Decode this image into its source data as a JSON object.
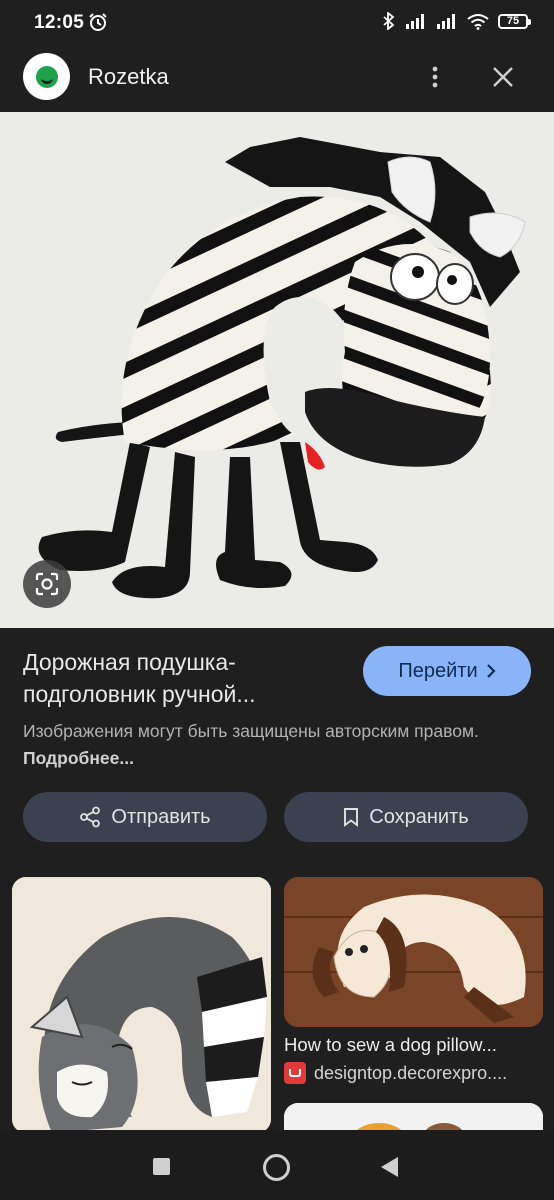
{
  "status_bar": {
    "time": "12:05",
    "battery": "75"
  },
  "app_bar": {
    "site_name": "Rozetka"
  },
  "result": {
    "title_line1": "Дорожная подушка-",
    "title_line2": "подголовник ручной...",
    "go_button": "Перейти",
    "copyright_text": "Изображения могут быть защищены авторским правом.",
    "copyright_link": "Подробнее..."
  },
  "actions": {
    "share": "Отправить",
    "save": "Сохранить"
  },
  "related": [
    {
      "title": "",
      "source": ""
    },
    {
      "title": "How to sew a dog pillow...",
      "source": "designtop.decorexpro...."
    },
    {
      "title": "",
      "source": ""
    }
  ],
  "colors": {
    "background": "#1f1f1f",
    "primary_button": "#8ab4f8",
    "secondary_button": "#3b4150"
  }
}
